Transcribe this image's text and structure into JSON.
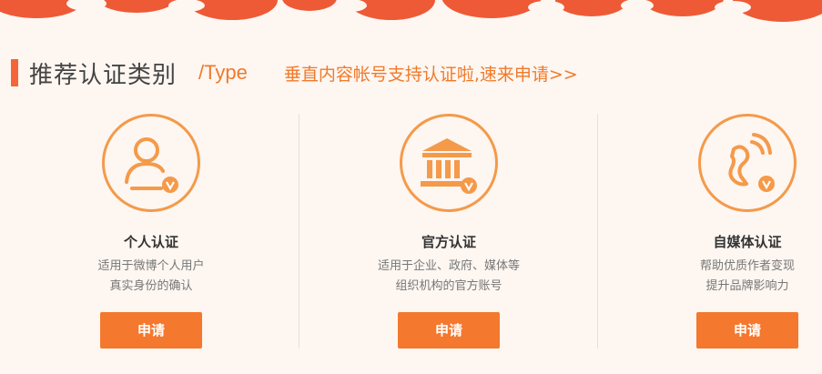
{
  "header": {
    "title": "推荐认证类别",
    "type_label": "/Type",
    "promo_link": "垂直内容帐号支持认证啦,速来申请>>"
  },
  "colors": {
    "accent": "#f4782e",
    "title_bar": "#f4663a",
    "icon": "#f49a4a"
  },
  "cards": [
    {
      "icon": "person-verified-icon",
      "title": "个人认证",
      "desc_line1": "适用于微博个人用户",
      "desc_line2": "真实身份的确认",
      "button": "申请"
    },
    {
      "icon": "institution-verified-icon",
      "title": "官方认证",
      "desc_line1": "适用于企业、政府、媒体等",
      "desc_line2": "组织机构的官方账号",
      "button": "申请"
    },
    {
      "icon": "media-verified-icon",
      "title": "自媒体认证",
      "desc_line1": "帮助优质作者变现",
      "desc_line2": "提升品牌影响力",
      "button": "申请"
    }
  ]
}
